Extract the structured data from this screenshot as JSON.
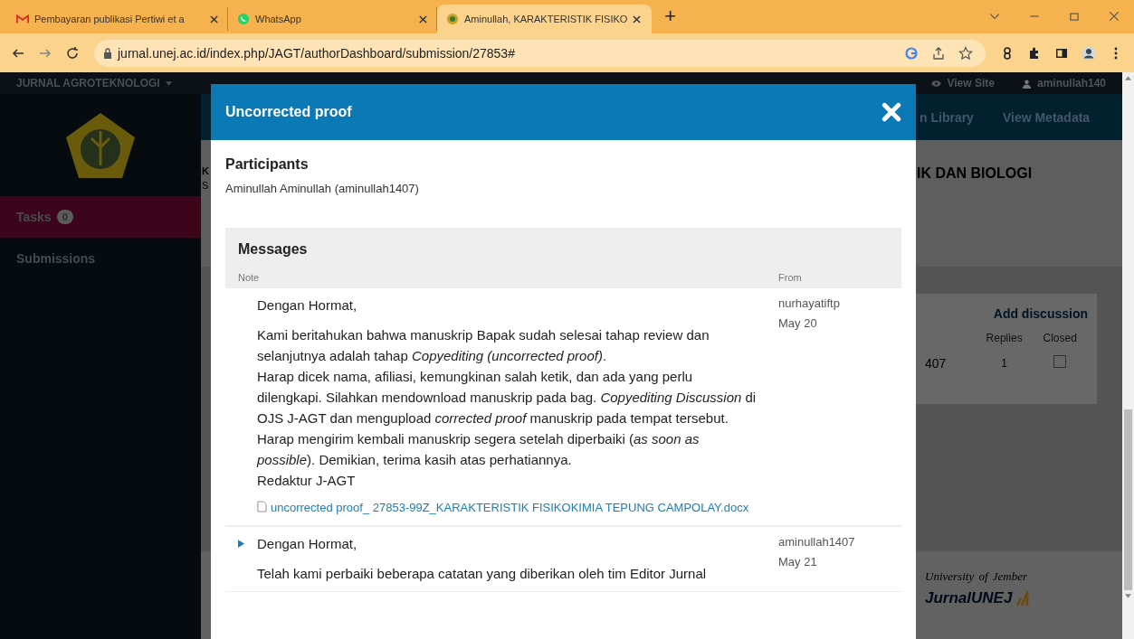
{
  "browser": {
    "tabs": [
      {
        "title": "Pembayaran publikasi Pertiwi et a",
        "selected": false
      },
      {
        "title": "WhatsApp",
        "selected": false
      },
      {
        "title": "Aminullah, KARAKTERISTIK FISIKO",
        "selected": true
      }
    ],
    "new_tab": "+",
    "url": "jurnal.unej.ac.id/index.php/JAGT/authorDashboard/submission/27853#"
  },
  "site": {
    "brand": "JURNAL AGROTEKNOLOGI",
    "top_links": [
      {
        "kind": "view",
        "label": "View Site"
      },
      {
        "kind": "user",
        "label": "aminullah140"
      }
    ],
    "nav": [
      "n Library",
      "View Metadata"
    ],
    "sidebar": [
      {
        "label": "Tasks",
        "count": "0",
        "selected": true
      },
      {
        "label": "Submissions",
        "selected": false
      }
    ],
    "title_fragments": [
      "K",
      "S"
    ],
    "title_end": "IK DAN BIOLOGI",
    "discussions": {
      "add": "Add discussion",
      "columns": [
        "Replies",
        "Closed"
      ],
      "rows": [
        {
          "from": "407",
          "replies": "1",
          "closed": false
        }
      ]
    },
    "footer": {
      "university": "University of Jember",
      "brand": "JurnalUNEJ"
    }
  },
  "modal": {
    "title": "Uncorrected proof",
    "participants_heading": "Participants",
    "participants": "Aminullah Aminullah (aminullah1407)",
    "messages_heading": "Messages",
    "columns": [
      "Note",
      "From"
    ],
    "messages": [
      {
        "expanded": true,
        "greeting": "Dengan Hormat,",
        "body": "Kami beritahukan bahwa manuskrip Bapak sudah selesai tahap review dan selanjutnya adalah tahap *Copyediting (uncorrected proof)*.\nHarap dicek nama, afiliasi, kemungkinan salah ketik, dan ada yang perlu dilengkapi. Silahkan mendownload manuskrip pada bag. *Copyediting Discussion* di OJS J-AGT dan mengupload *corrected proof* manuskrip pada tempat tersebut. Harap mengirim kembali manuskrip segera setelah diperbaiki (*as soon as possible*). Demikian, terima kasih atas perhatiannya.\nRedaktur J-AGT",
        "attachment": "uncorrected proof_ 27853-99Z_KARAKTERISTIK FISIKOKIMIA TEPUNG CAMPOLAY.docx",
        "from": "nurhayatiftp",
        "date": "May 20"
      },
      {
        "expanded": false,
        "greeting": "Dengan Hormat,",
        "body": "Telah kami perbaiki beberapa catatan yang diberikan oleh tim Editor Jurnal",
        "from": "aminullah1407",
        "date": "May 21"
      }
    ]
  }
}
